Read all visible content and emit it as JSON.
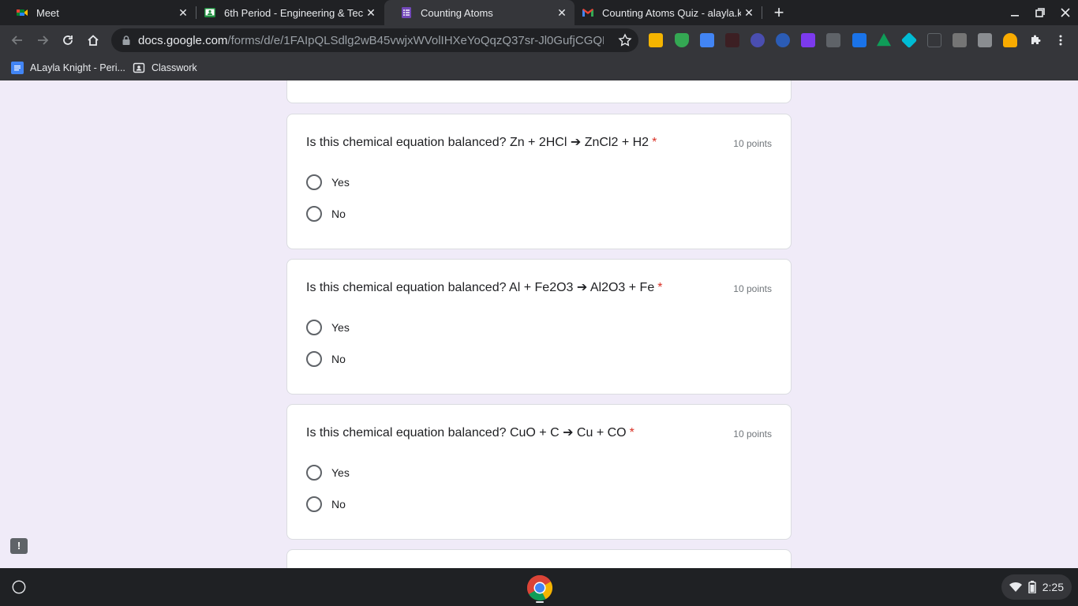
{
  "browser": {
    "tabs": [
      {
        "title": "Meet",
        "icon": "google-meet-icon"
      },
      {
        "title": "6th Period - Engineering & Techn",
        "icon": "google-classroom-icon"
      },
      {
        "title": "Counting Atoms",
        "icon": "google-forms-icon",
        "active": true
      },
      {
        "title": "Counting Atoms Quiz - alayla.kn",
        "icon": "gmail-icon"
      }
    ],
    "url_host": "docs.google.com",
    "url_path": "/forms/d/e/1FAIpQLSdlg2wB45vwjxWVolIHXeYoQqzQ37sr-Jl0GufjCGQRba...",
    "bookmarks": [
      {
        "label": "ALayla Knight - Peri..."
      },
      {
        "label": "Classwork"
      }
    ]
  },
  "questions": [
    {
      "prompt": "Is this chemical equation balanced? Zn + 2HCl ➔ ZnCl2 + H2",
      "required": "*",
      "points": "10 points",
      "options": [
        "Yes",
        "No"
      ]
    },
    {
      "prompt": "Is this chemical equation balanced? Al + Fe2O3 ➔ Al2O3 + Fe",
      "required": "*",
      "points": "10 points",
      "options": [
        "Yes",
        "No"
      ]
    },
    {
      "prompt": "Is this chemical equation balanced? CuO + C ➔ Cu + CO",
      "required": "*",
      "points": "10 points",
      "options": [
        "Yes",
        "No"
      ]
    }
  ],
  "feedback_label": "!",
  "shelf": {
    "time": "2:25"
  }
}
